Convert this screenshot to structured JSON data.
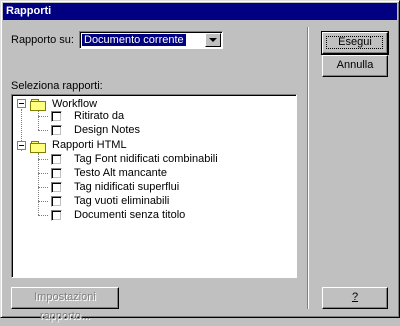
{
  "window": {
    "title": "Rapporti"
  },
  "report_on": {
    "label": "Rapporto su:",
    "selected_value": "Documento corrente"
  },
  "reports_list": {
    "label": "Seleziona rapporti:",
    "groups": [
      {
        "name": "Workflow",
        "items": [
          {
            "label": "Ritirato da",
            "checked": false
          },
          {
            "label": "Design Notes",
            "checked": false
          }
        ]
      },
      {
        "name": "Rapporti HTML",
        "items": [
          {
            "label": "Tag Font nidificati combinabili",
            "checked": false
          },
          {
            "label": "Testo Alt mancante",
            "checked": false
          },
          {
            "label": "Tag nidificati superflui",
            "checked": false
          },
          {
            "label": "Tag vuoti eliminabili",
            "checked": false
          },
          {
            "label": "Documenti senza titolo",
            "checked": false
          }
        ]
      }
    ]
  },
  "buttons": {
    "run": "Esegui",
    "cancel": "Annulla",
    "settings": "Impostazioni rapporto...",
    "help": "?"
  }
}
